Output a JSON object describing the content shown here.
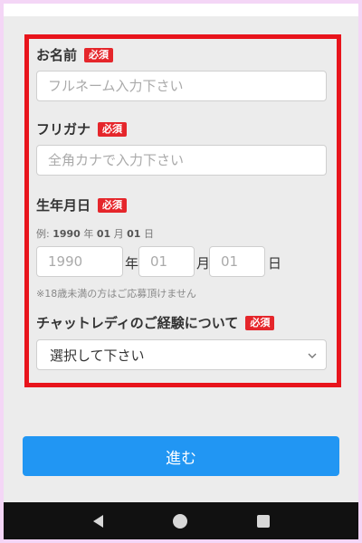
{
  "form": {
    "required_badge": "必須",
    "name": {
      "label": "お名前",
      "placeholder": "フルネーム入力下さい",
      "value": ""
    },
    "kana": {
      "label": "フリガナ",
      "placeholder": "全角カナで入力下さい",
      "value": ""
    },
    "birthday": {
      "label": "生年月日",
      "example_prefix": "例: ",
      "example_year": "1990",
      "example_year_unit": " 年 ",
      "example_month": "01",
      "example_month_unit": " 月 ",
      "example_day": "01",
      "example_day_unit": " 日",
      "year_placeholder": "1990",
      "month_placeholder": "01",
      "day_placeholder": "01",
      "year_unit": "年",
      "month_unit": "月",
      "day_unit": "日",
      "note": "※18歳未満の方はご応募頂けません"
    },
    "experience": {
      "label": "チャットレディのご経験について",
      "selected": "選択して下さい"
    },
    "submit_label": "進む"
  },
  "colors": {
    "highlight_border": "#e8141c",
    "badge": "#e5262b",
    "submit": "#2196f3",
    "page_background": "#ececec",
    "outer_frame": "#f4d6f6"
  },
  "icons": {
    "select_chevron": "chevron-down-icon",
    "nav_back": "back-triangle-icon",
    "nav_home": "home-circle-icon",
    "nav_recents": "recents-square-icon"
  }
}
